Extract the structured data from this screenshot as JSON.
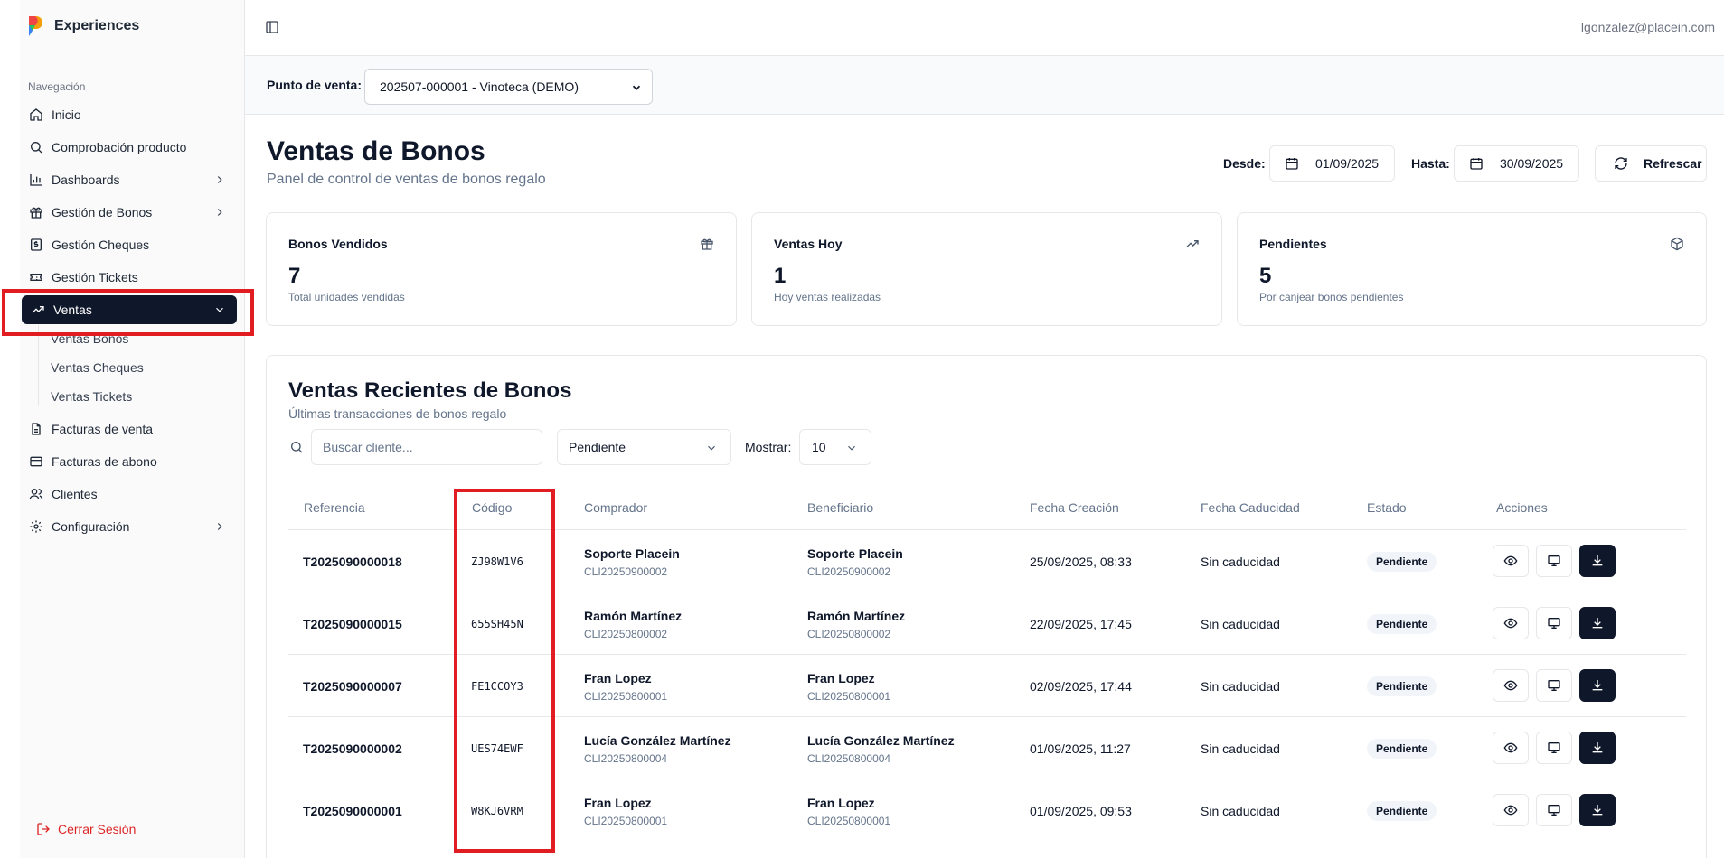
{
  "app": {
    "name": "Experiences",
    "user_email": "lgonzalez@placein.com",
    "logout_label": "Cerrar Sesión"
  },
  "sidebar": {
    "heading": "Navegación",
    "items": [
      {
        "label": "Inicio",
        "icon": "home-icon"
      },
      {
        "label": "Comprobación producto",
        "icon": "search-icon"
      },
      {
        "label": "Dashboards",
        "icon": "bar-chart-icon"
      },
      {
        "label": "Gestión de Bonos",
        "icon": "gift-icon"
      },
      {
        "label": "Gestión Cheques",
        "icon": "receipt-icon"
      },
      {
        "label": "Gestión Tickets",
        "icon": "ticket-icon"
      },
      {
        "label": "Ventas",
        "icon": "trending-up-icon"
      },
      {
        "label": "Facturas de venta",
        "icon": "file-icon"
      },
      {
        "label": "Facturas de abono",
        "icon": "credit-card-icon"
      },
      {
        "label": "Clientes",
        "icon": "users-icon"
      },
      {
        "label": "Configuración",
        "icon": "gear-icon"
      }
    ],
    "ventas_sub": [
      "Ventas Bonos",
      "Ventas Cheques",
      "Ventas Tickets"
    ]
  },
  "pos": {
    "label": "Punto de venta:",
    "selected": "202507-000001 - Vinoteca (DEMO)"
  },
  "header": {
    "title": "Ventas de Bonos",
    "subtitle": "Panel de control de ventas de bonos regalo",
    "from_label": "Desde:",
    "from_value": "01/09/2025",
    "to_label": "Hasta:",
    "to_value": "30/09/2025",
    "refresh_label": "Refrescar"
  },
  "stats": [
    {
      "title": "Bonos Vendidos",
      "value": "7",
      "desc": "Total unidades vendidas",
      "icon": "gift-icon"
    },
    {
      "title": "Ventas Hoy",
      "value": "1",
      "desc": "Hoy ventas realizadas",
      "icon": "trending-up-icon"
    },
    {
      "title": "Pendientes",
      "value": "5",
      "desc": "Por canjear bonos pendientes",
      "icon": "package-icon"
    }
  ],
  "table": {
    "title": "Ventas Recientes de Bonos",
    "subtitle": "Últimas transacciones de bonos regalo",
    "search_placeholder": "Buscar cliente...",
    "status_filter": "Pendiente",
    "show_label": "Mostrar:",
    "show_value": "10",
    "columns": [
      "Referencia",
      "Código",
      "Comprador",
      "Beneficiario",
      "Fecha Creación",
      "Fecha Caducidad",
      "Estado",
      "Acciones"
    ],
    "rows": [
      {
        "ref": "T2025090000018",
        "code": "ZJ98W1V6",
        "buyer": "Soporte Placein",
        "buyer_id": "CLI20250900002",
        "beneficiary": "Soporte Placein",
        "beneficiary_id": "CLI20250900002",
        "created": "25/09/2025, 08:33",
        "expiry": "Sin caducidad",
        "status": "Pendiente"
      },
      {
        "ref": "T2025090000015",
        "code": "655SH45N",
        "buyer": "Ramón Martínez",
        "buyer_id": "CLI20250800002",
        "beneficiary": "Ramón Martínez",
        "beneficiary_id": "CLI20250800002",
        "created": "22/09/2025, 17:45",
        "expiry": "Sin caducidad",
        "status": "Pendiente"
      },
      {
        "ref": "T2025090000007",
        "code": "FE1CCOY3",
        "buyer": "Fran Lopez",
        "buyer_id": "CLI20250800001",
        "beneficiary": "Fran Lopez",
        "beneficiary_id": "CLI20250800001",
        "created": "02/09/2025, 17:44",
        "expiry": "Sin caducidad",
        "status": "Pendiente"
      },
      {
        "ref": "T2025090000002",
        "code": "UES74EWF",
        "buyer": "Lucía González Martínez",
        "buyer_id": "CLI20250800004",
        "beneficiary": "Lucía González Martínez",
        "beneficiary_id": "CLI20250800004",
        "created": "01/09/2025, 11:27",
        "expiry": "Sin caducidad",
        "status": "Pendiente"
      },
      {
        "ref": "T2025090000001",
        "code": "W8KJ6VRM",
        "buyer": "Fran Lopez",
        "buyer_id": "CLI20250800001",
        "beneficiary": "Fran Lopez",
        "beneficiary_id": "CLI20250800001",
        "created": "01/09/2025, 09:53",
        "expiry": "Sin caducidad",
        "status": "Pendiente"
      }
    ]
  },
  "colors": {
    "primary": "#0f172a",
    "muted": "#64748b",
    "border": "#e5e7eb",
    "highlight": "#e11d22",
    "logout": "#dc2626"
  }
}
